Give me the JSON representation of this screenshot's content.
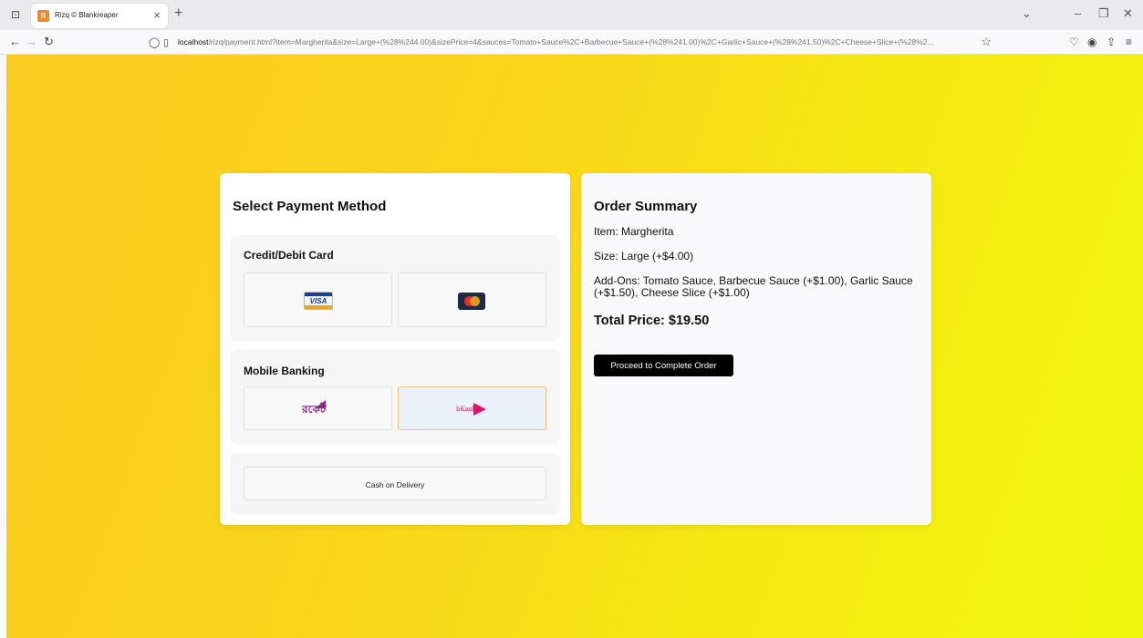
{
  "browser": {
    "tab_title": "Rizq © Blankreaper",
    "favicon_letter": "R",
    "url_host": "localhost",
    "url_path": "/rizq/payment.html?item=Margherita&size=Large+(%28%244.00)&sizePrice=4&sauces=Tomato+Sauce%2C+Barbecue+Sauce+(%28%241.00)%2C+Garlic+Sauce+(%28%241.50)%2C+Cheese+Slice+(%28%2..."
  },
  "payment": {
    "title": "Select Payment Method",
    "card_section_title": "Credit/Debit Card",
    "visa_text": "VISA",
    "mobile_section_title": "Mobile Banking",
    "rocket_text": "রকেট",
    "bkash_text": "bKash",
    "cod_label": "Cash on Delivery"
  },
  "summary": {
    "title": "Order Summary",
    "item": "Item: Margherita",
    "size": "Size: Large (+$4.00)",
    "addons": "Add-Ons: Tomato Sauce, Barbecue Sauce (+$1.00), Garlic Sauce (+$1.50), Cheese Slice (+$1.00)",
    "total": "Total Price: $19.50",
    "proceed_label": "Proceed to Complete Order"
  },
  "colors": {
    "gradient_start": "#f9cb23",
    "gradient_end": "#f2f80c",
    "selected_option_bg": "#eaf1fb",
    "proceed_bg": "#000000"
  },
  "selected_payment": "bkash"
}
